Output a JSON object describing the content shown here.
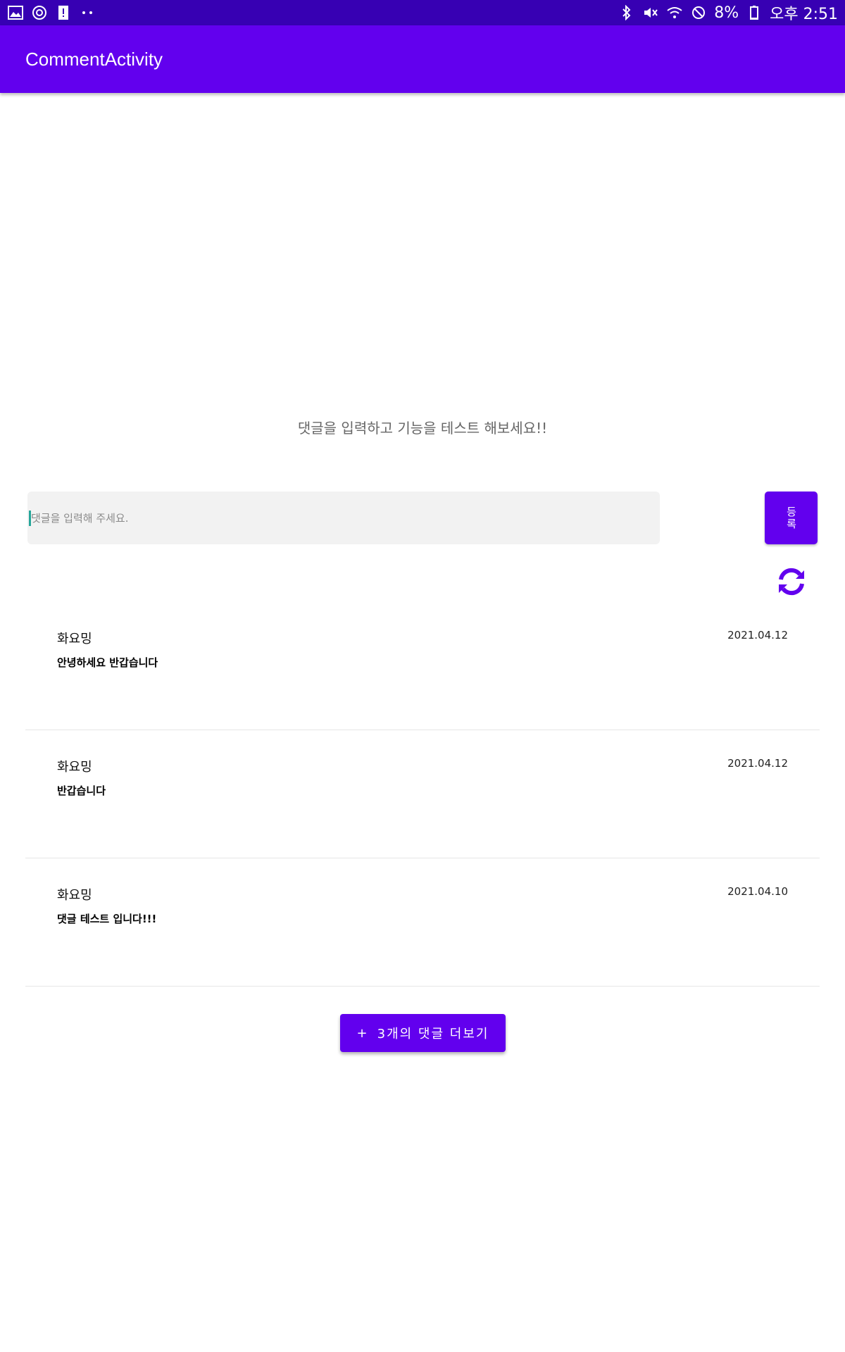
{
  "status_bar": {
    "battery_percent": "8%",
    "time": "오후 2:51",
    "left_icons": [
      "image-icon",
      "sync-icon",
      "alert-icon",
      "more-dots-icon"
    ],
    "right_icons": [
      "bluetooth-icon",
      "mute-icon",
      "wifi-icon",
      "do-not-disturb-icon",
      "battery-icon"
    ]
  },
  "app_bar": {
    "title": "CommentActivity",
    "color": "#6200ee"
  },
  "prompt": {
    "text": "댓글을 입력하고 기능을 테스트 해보세요!!"
  },
  "comment_input": {
    "placeholder": "댓글을 입력해 주세요.",
    "value": ""
  },
  "submit_button": {
    "label": "등록"
  },
  "refresh": {
    "icon": "refresh-icon"
  },
  "comments": [
    {
      "author": "화요밍",
      "body": "안녕하세요 반갑습니다",
      "date": "2021.04.12"
    },
    {
      "author": "화요밍",
      "body": "반갑습니다",
      "date": "2021.04.12"
    },
    {
      "author": "화요밍",
      "body": "댓글 테스트 입니다!!!",
      "date": "2021.04.10"
    }
  ],
  "more_button": {
    "icon": "+",
    "label": "3개의 댓글 더보기"
  }
}
